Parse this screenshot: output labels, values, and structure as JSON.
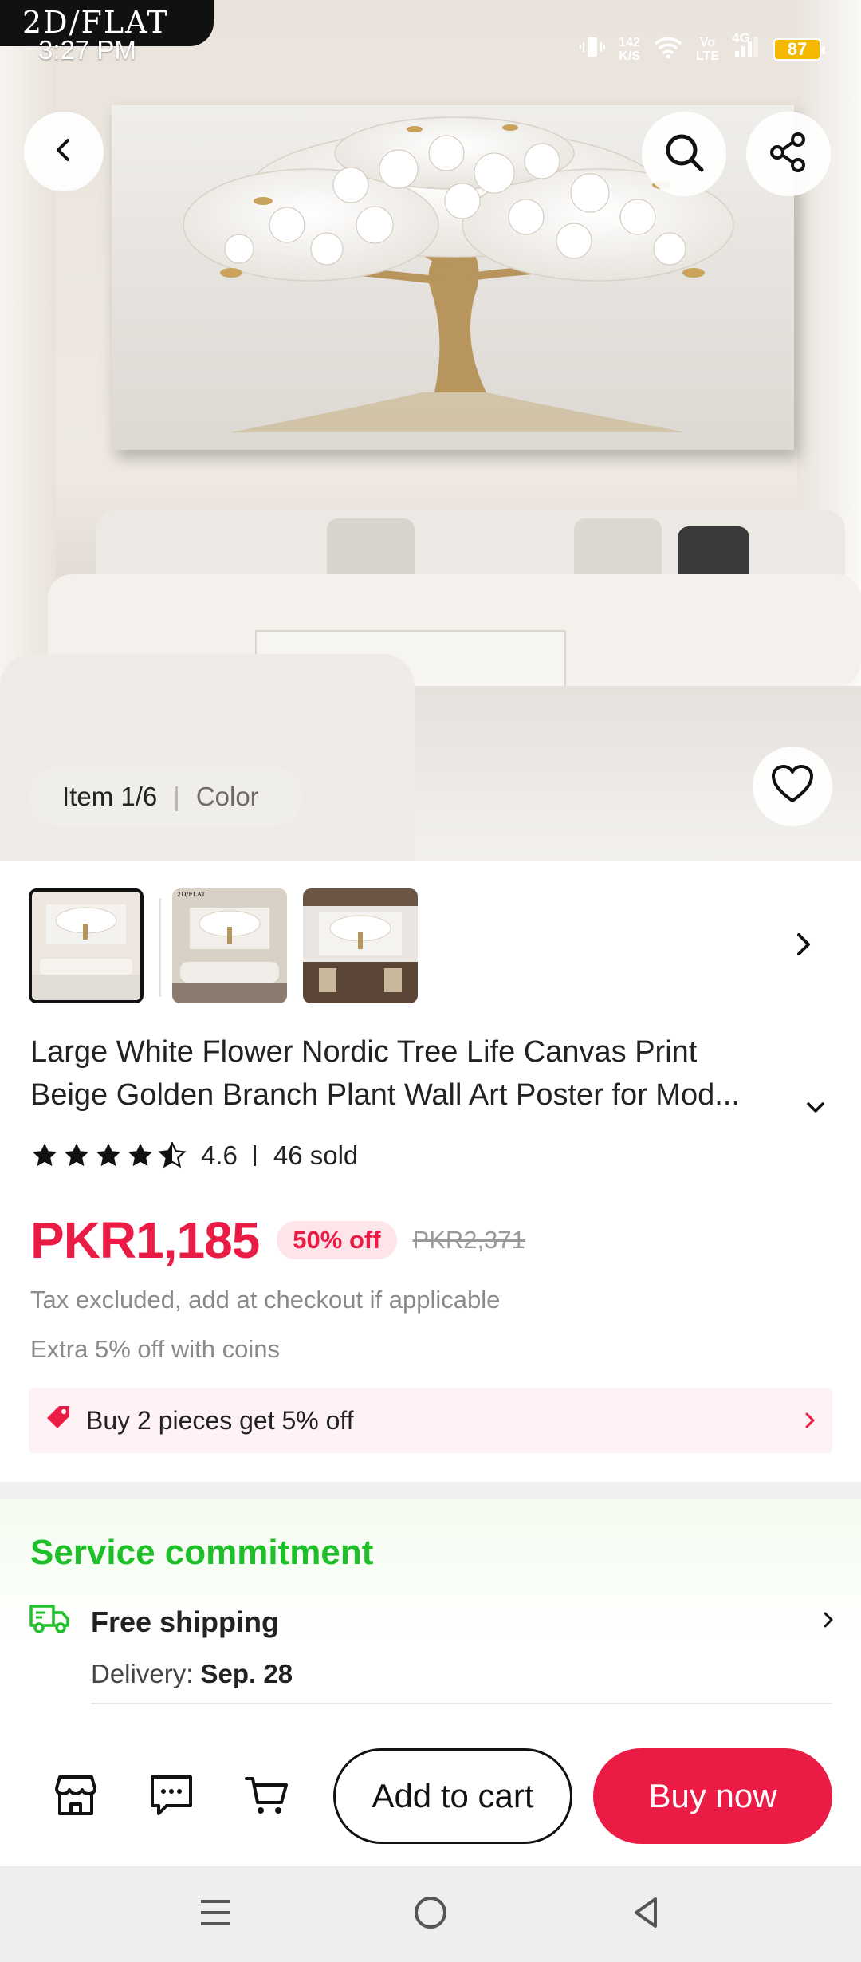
{
  "status_bar": {
    "badge": "2D/FLAT",
    "time": "3:27 PM",
    "net_speed_value": "142",
    "net_speed_unit": "K/S",
    "volte_top": "Vo",
    "volte_bottom": "LTE",
    "network": "4G",
    "battery": "87",
    "icons": [
      "vibrate-icon",
      "wifi-icon",
      "signal-icon",
      "battery-icon"
    ]
  },
  "gallery": {
    "item_label": "Item 1/6",
    "color_label": "Color",
    "thumb_badge": "2D/FLAT",
    "thumbnails_count": 3
  },
  "product": {
    "title_line1": "Large White Flower Nordic Tree Life Canvas Print",
    "title_line2": "Beige Golden Branch Plant Wall Art Poster for Mod...",
    "rating": "4.6",
    "sold": "46 sold",
    "stars_filled": 4.5,
    "price": "PKR1,185",
    "discount": "50% off",
    "original_price": "PKR2,371",
    "tax_note": "Tax excluded, add at checkout if applicable",
    "coins_note": "Extra 5% off with coins",
    "promo": "Buy 2 pieces get 5% off"
  },
  "service": {
    "title": "Service commitment",
    "shipping": "Free shipping",
    "delivery_label": "Delivery:",
    "delivery_date": "Sep. 28"
  },
  "actions": {
    "add_to_cart": "Add to cart",
    "buy_now": "Buy now"
  },
  "colors": {
    "accent": "#ea1c45",
    "service_green": "#1fbf2a",
    "promo_bg": "#fff2f4"
  }
}
